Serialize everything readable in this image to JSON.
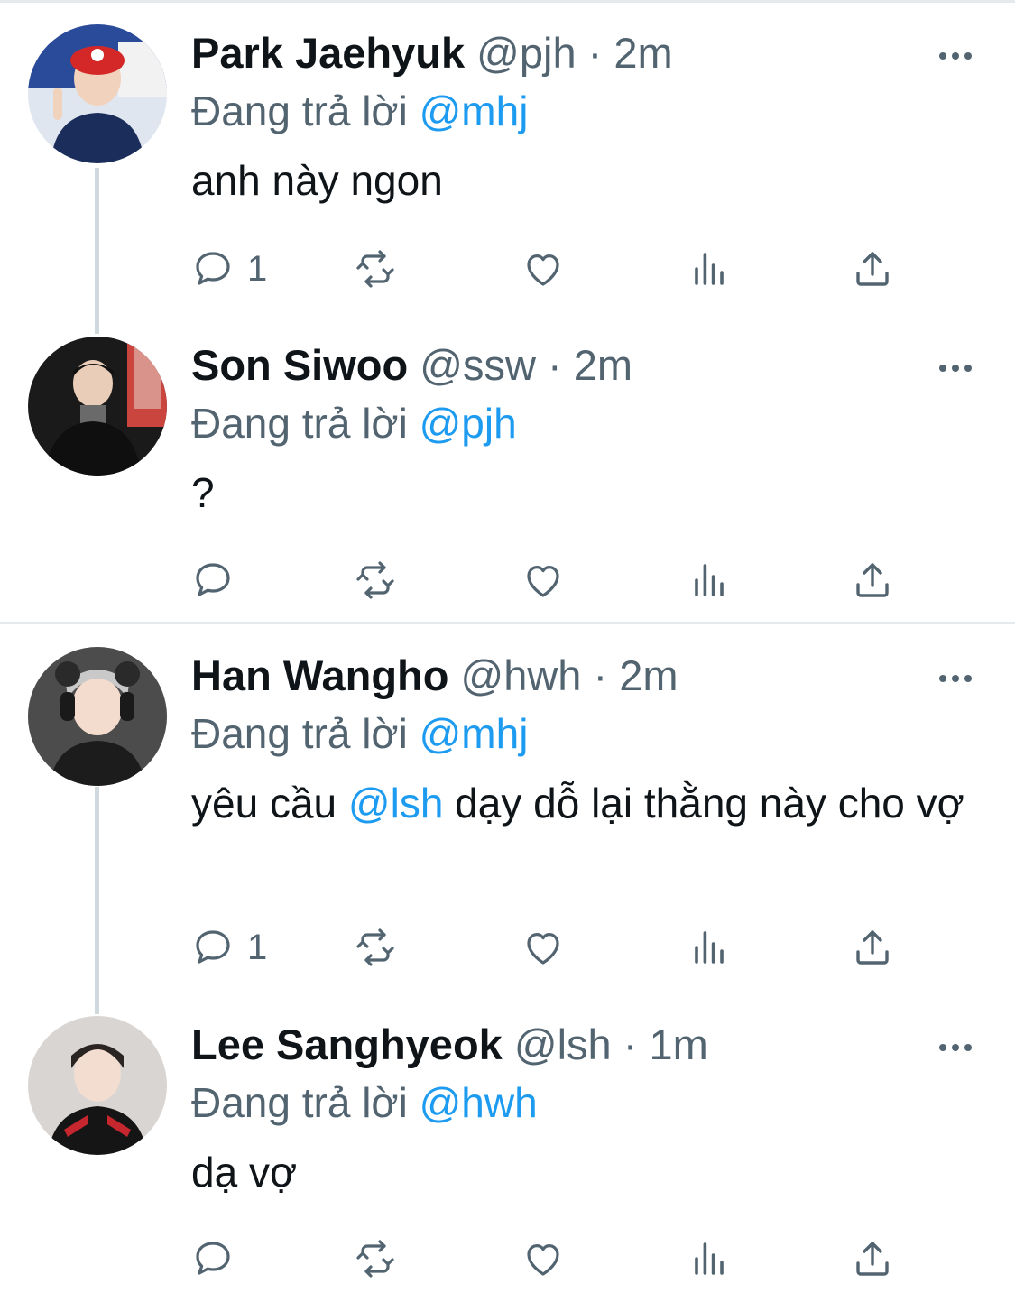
{
  "tweets": [
    {
      "name": "Park Jaehyuk",
      "handle": "@pjh",
      "separator": "·",
      "time": "2m",
      "reply_prefix": "Đang trả lời",
      "reply_to": "@mhj",
      "text_parts": [
        "anh này ngon"
      ],
      "reply_count": "1"
    },
    {
      "name": "Son Siwoo",
      "handle": "@ssw",
      "separator": "·",
      "time": "2m",
      "reply_prefix": "Đang trả lời",
      "reply_to": "@pjh",
      "text_parts": [
        "?"
      ],
      "reply_count": ""
    },
    {
      "name": "Han Wangho",
      "handle": "@hwh",
      "separator": "·",
      "time": "2m",
      "reply_prefix": "Đang trả lời",
      "reply_to": "@mhj",
      "text_parts": [
        "yêu cầu ",
        "@lsh",
        " dạy dỗ lại thằng này cho vợ"
      ],
      "reply_count": "1"
    },
    {
      "name": "Lee Sanghyeok",
      "handle": "@lsh",
      "separator": "·",
      "time": "1m",
      "reply_prefix": "Đang trả lời",
      "reply_to": "@hwh",
      "text_parts": [
        "dạ vợ"
      ],
      "reply_count": ""
    }
  ],
  "colors": {
    "mention": "#1d9bf0",
    "secondary_text": "#536471",
    "thread_line": "#cfd9de"
  },
  "icons": [
    "reply-icon",
    "retweet-icon",
    "like-icon",
    "views-icon",
    "share-icon",
    "more-icon"
  ]
}
